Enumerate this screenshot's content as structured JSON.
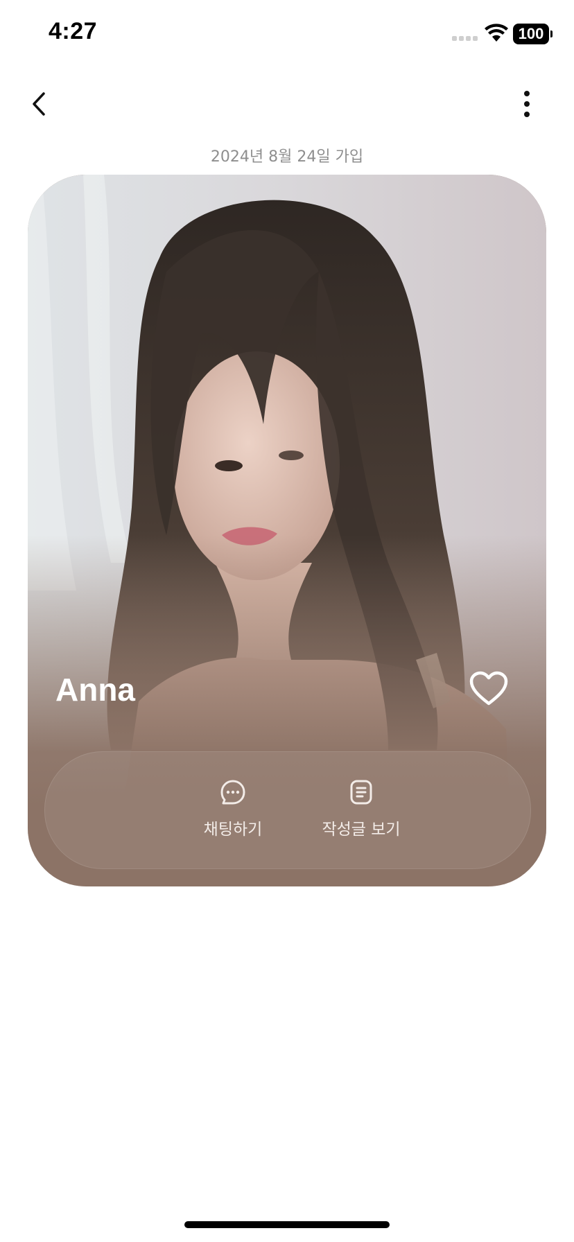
{
  "status_bar": {
    "time": "4:27",
    "battery": "100",
    "icons": [
      "signal-icon",
      "wifi-icon",
      "battery-icon"
    ]
  },
  "nav": {
    "back_icon": "chevron-left-icon",
    "more_icon": "more-vertical-icon"
  },
  "profile": {
    "joined": "2024년 8월 24일 가입",
    "name": "Anna",
    "like_icon": "heart-outline-icon",
    "accent_color": "#8c7366"
  },
  "actions": [
    {
      "label": "채팅하기",
      "icon": "chat-bubble-icon"
    },
    {
      "label": "작성글 보기",
      "icon": "document-icon"
    }
  ]
}
